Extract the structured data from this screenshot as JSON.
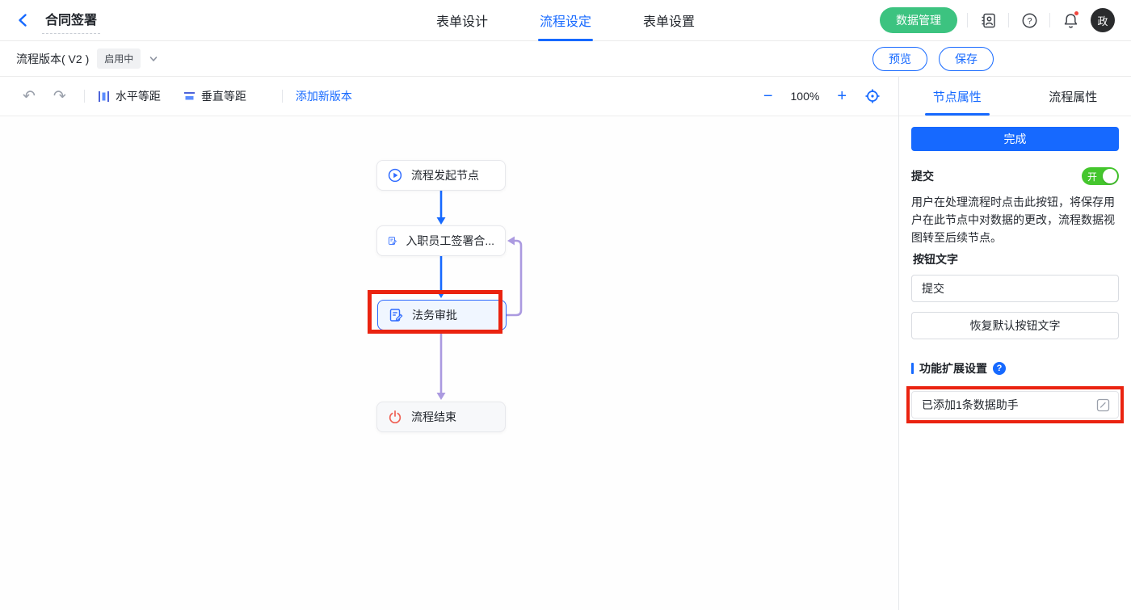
{
  "header": {
    "title": "合同签署",
    "tabs": [
      {
        "label": "表单设计",
        "active": false
      },
      {
        "label": "流程设定",
        "active": true
      },
      {
        "label": "表单设置",
        "active": false
      }
    ],
    "data_manage_label": "数据管理",
    "avatar_text": "政"
  },
  "version_bar": {
    "version_label": "流程版本( V2 )",
    "status_badge": "启用中",
    "preview_label": "预览",
    "save_label": "保存"
  },
  "toolbar": {
    "undo_glyph": "↶",
    "redo_glyph": "↷",
    "h_equal_label": "水平等距",
    "v_equal_label": "垂直等距",
    "add_version_label": "添加新版本",
    "zoom_out_glyph": "−",
    "zoom_level": "100%",
    "zoom_in_glyph": "+"
  },
  "canvas": {
    "nodes": [
      {
        "label": "流程发起节点",
        "type": "start"
      },
      {
        "label": "入职员工签署合...",
        "type": "task"
      },
      {
        "label": "法务审批",
        "type": "task",
        "selected": true,
        "annotated": true
      },
      {
        "label": "流程结束",
        "type": "end"
      }
    ]
  },
  "panel": {
    "tabs": [
      {
        "label": "节点属性",
        "active": true
      },
      {
        "label": "流程属性",
        "active": false
      }
    ],
    "done_label": "完成",
    "submit": {
      "label": "提交",
      "toggle_state": "开",
      "description": "用户在处理流程时点击此按钮，将保存用户在此节点中对数据的更改，流程数据视图转至后续节点。",
      "button_text_label": "按钮文字",
      "button_text_value": "提交",
      "restore_label": "恢复默认按钮文字"
    },
    "extension": {
      "title": "功能扩展设置",
      "help_glyph": "?",
      "assistant_text": "已添加1条数据助手"
    }
  },
  "colors": {
    "accent_blue": "#1669ff",
    "node_icon_blue": "#2f6bff",
    "edge_purple": "#ab9ae0",
    "end_icon_red": "#ef6256",
    "data_manage_green": "#3cc380",
    "toggle_green": "#44c62d",
    "annotation_red": "#ea2310"
  }
}
